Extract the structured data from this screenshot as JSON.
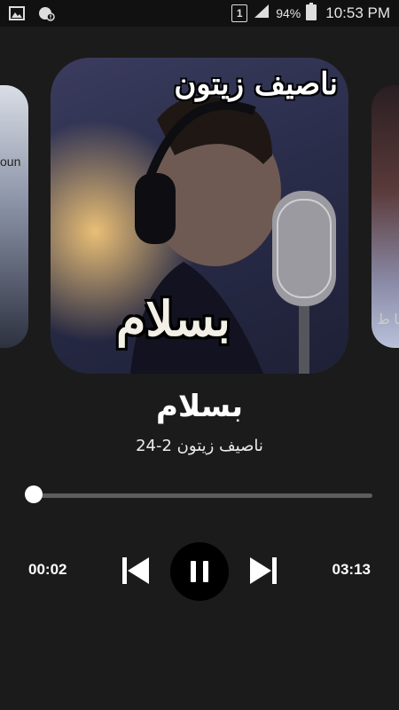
{
  "status_bar": {
    "sim": "1",
    "battery_percent": "94%",
    "time": "10:53 PM",
    "icons": [
      "gallery-icon",
      "sync-alert-icon",
      "signal-icon",
      "battery-icon"
    ]
  },
  "carousel": {
    "prev_cover_text": "oun",
    "current_cover_text_top": "ناصيف زيتون",
    "current_cover_text_bottom": "بسلام",
    "next_cover_text": "يا ط"
  },
  "track": {
    "title": "بسلام",
    "subtitle": "ناصيف زيتون 2-24"
  },
  "player": {
    "elapsed": "00:02",
    "duration": "03:13",
    "progress_fraction": 0.01,
    "state": "playing",
    "icons": [
      "previous-icon",
      "pause-icon",
      "next-icon"
    ]
  }
}
